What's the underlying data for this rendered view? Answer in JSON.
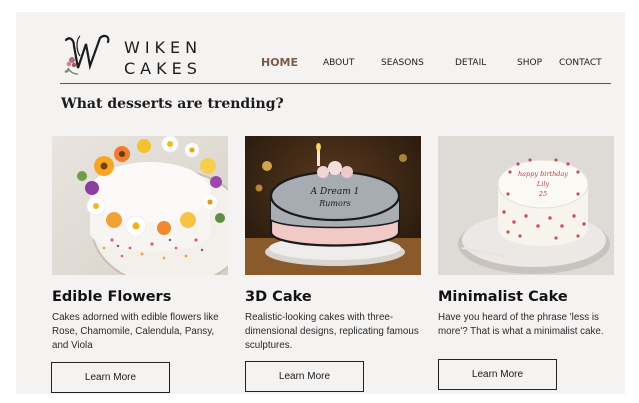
{
  "brand": {
    "line1": "WIKEN",
    "line2": "CAKES"
  },
  "nav": [
    {
      "label": "HOME",
      "active": true
    },
    {
      "label": "ABOUT"
    },
    {
      "label": "SEASONS"
    },
    {
      "label": "DETAIL"
    },
    {
      "label": "SHOP"
    },
    {
      "label": "CONTACT"
    }
  ],
  "section": {
    "title": "What desserts are trending?"
  },
  "cards": [
    {
      "title": "Edible Flowers",
      "description": "Cakes adorned with edible flowers like Rose, Chamomile, Calendula, Pansy, and Viola",
      "button": "Learn More"
    },
    {
      "title": "3D Cake",
      "description": "Realistic-looking cakes with three-dimensional designs, replicating famous sculptures.",
      "button": "Learn More"
    },
    {
      "title": "Minimalist Cake",
      "description": "Have you heard of the phrase 'less is more'? That is what a minimalist cake.",
      "button": "Learn More"
    }
  ],
  "colors": {
    "background": "#f5f3f2",
    "accent": "#7b5a47",
    "text": "#121212"
  }
}
